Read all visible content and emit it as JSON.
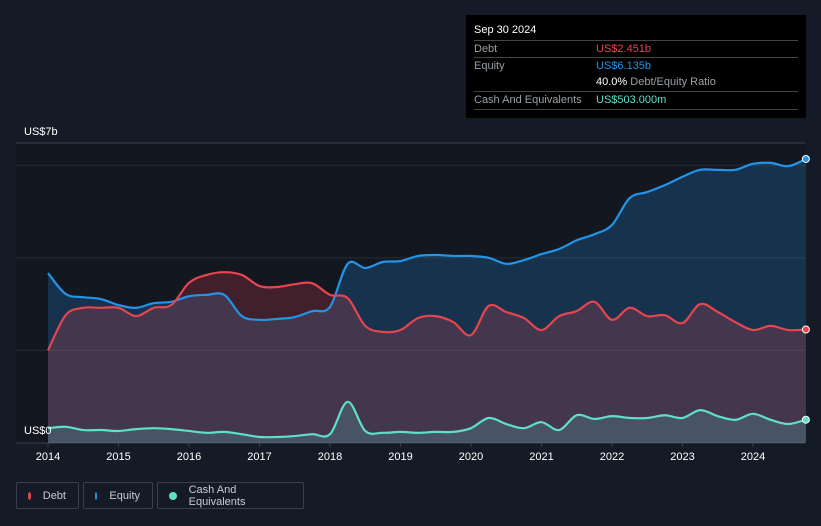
{
  "tooltip": {
    "date": "Sep 30 2024",
    "debt_label": "Debt",
    "debt_value": "US$2.451b",
    "equity_label": "Equity",
    "equity_value": "US$6.135b",
    "ratio_value": "40.0%",
    "ratio_label": "Debt/Equity Ratio",
    "cash_label": "Cash And Equivalents",
    "cash_value": "US$503.000m"
  },
  "legend": {
    "debt": "Debt",
    "equity": "Equity",
    "cash": "Cash And Equivalents"
  },
  "colors": {
    "debt": "#e64550",
    "equity": "#2394e8",
    "cash": "#5ee0c8",
    "background": "#151b26"
  },
  "chart_data": {
    "type": "area",
    "ylabel_top": "US$7b",
    "ylabel_bottom": "US$0",
    "ylim": [
      0,
      6.48
    ],
    "xlim": [
      2013.6,
      2024.8
    ],
    "grid": true,
    "gridlines": [
      2,
      4,
      6
    ],
    "x_ticks": [
      "2014",
      "2015",
      "2016",
      "2017",
      "2018",
      "2019",
      "2020",
      "2021",
      "2022",
      "2023",
      "2024"
    ],
    "x": [
      2014,
      2014.25,
      2014.5,
      2014.75,
      2015,
      2015.25,
      2015.5,
      2015.75,
      2016,
      2016.25,
      2016.5,
      2016.75,
      2017,
      2017.25,
      2017.5,
      2017.75,
      2018,
      2018.25,
      2018.5,
      2018.75,
      2019,
      2019.25,
      2019.5,
      2019.75,
      2020,
      2020.25,
      2020.5,
      2020.75,
      2021,
      2021.25,
      2021.5,
      2021.75,
      2022,
      2022.25,
      2022.5,
      2022.75,
      2023,
      2023.25,
      2023.5,
      2023.75,
      2024,
      2024.25,
      2024.5,
      2024.75
    ],
    "series": [
      {
        "name": "Debt",
        "values": [
          2.0,
          2.76,
          2.92,
          2.92,
          2.92,
          2.74,
          2.92,
          2.98,
          3.46,
          3.63,
          3.69,
          3.63,
          3.39,
          3.37,
          3.43,
          3.45,
          3.2,
          3.13,
          2.53,
          2.4,
          2.44,
          2.7,
          2.74,
          2.61,
          2.33,
          2.96,
          2.83,
          2.7,
          2.44,
          2.74,
          2.85,
          3.05,
          2.66,
          2.92,
          2.74,
          2.76,
          2.59,
          3.0,
          2.83,
          2.61,
          2.44,
          2.53,
          2.44,
          2.451
        ]
      },
      {
        "name": "Equity",
        "values": [
          3.67,
          3.22,
          3.15,
          3.11,
          2.98,
          2.92,
          3.02,
          3.05,
          3.17,
          3.2,
          3.2,
          2.74,
          2.66,
          2.68,
          2.72,
          2.85,
          2.94,
          3.87,
          3.78,
          3.91,
          3.93,
          4.04,
          4.06,
          4.04,
          4.04,
          4.0,
          3.87,
          3.95,
          4.08,
          4.19,
          4.38,
          4.51,
          4.71,
          5.29,
          5.42,
          5.57,
          5.75,
          5.9,
          5.9,
          5.9,
          6.03,
          6.05,
          5.98,
          6.135
        ]
      },
      {
        "name": "Cash And Equivalents",
        "values": [
          0.32,
          0.35,
          0.28,
          0.28,
          0.26,
          0.3,
          0.32,
          0.3,
          0.26,
          0.22,
          0.24,
          0.19,
          0.13,
          0.13,
          0.15,
          0.19,
          0.19,
          0.89,
          0.26,
          0.22,
          0.24,
          0.22,
          0.24,
          0.24,
          0.32,
          0.54,
          0.41,
          0.32,
          0.45,
          0.28,
          0.6,
          0.52,
          0.58,
          0.54,
          0.54,
          0.6,
          0.54,
          0.71,
          0.58,
          0.5,
          0.63,
          0.5,
          0.41,
          0.503
        ]
      }
    ]
  }
}
